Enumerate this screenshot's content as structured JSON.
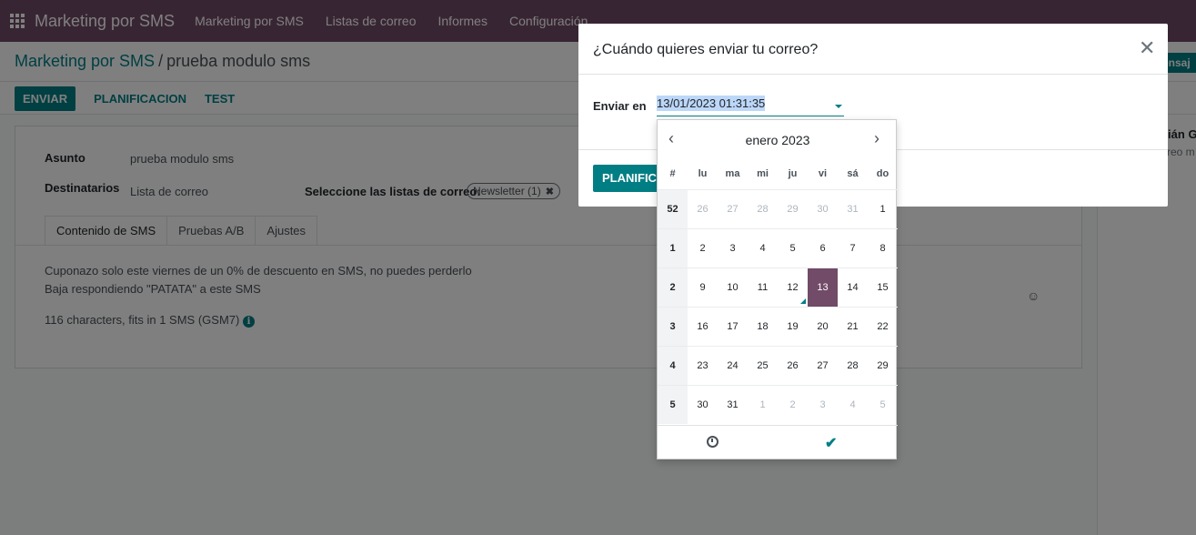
{
  "navbar": {
    "brand": "Marketing por SMS",
    "menu": [
      "Marketing por SMS",
      "Listas de correo",
      "Informes",
      "Configuración"
    ]
  },
  "breadcrumb": {
    "parent": "Marketing por SMS",
    "separator": "/",
    "current": "prueba modulo sms"
  },
  "actions": {
    "send": "ENVIAR",
    "schedule": "PLANIFICACION",
    "test": "TEST"
  },
  "form": {
    "subject_label": "Asunto",
    "subject_value": "prueba modulo sms",
    "recipients_label": "Destinatarios",
    "recipients_value": "Lista de correo",
    "lists_label": "Seleccione las listas de correo:",
    "list_tag": "Newsletter (1)",
    "tabs": [
      "Contenido de SMS",
      "Pruebas A/B",
      "Ajustes"
    ],
    "body_line1": "Cuponazo solo este viernes de un 0% de descuento en SMS, no puedes perderlo",
    "body_line2": "Baja respondiendo \"PATATA\" a este SMS",
    "char_info": "116 characters, fits in 1 SMS (GSM7)"
  },
  "chatter": {
    "button": "ensaj",
    "name": "rián G",
    "sub": "rreo m"
  },
  "modal": {
    "title": "¿Cuándo quieres enviar tu correo?",
    "send_at_label": "Enviar en",
    "send_at_value": "13/01/2023 01:31:35",
    "plan_button": "PLANIFICAR"
  },
  "datepicker": {
    "month_label": "enero 2023",
    "headers": [
      "#",
      "lu",
      "ma",
      "mi",
      "ju",
      "vi",
      "sá",
      "do"
    ],
    "weeks": [
      {
        "wk": "52",
        "days": [
          "26",
          "27",
          "28",
          "29",
          "30",
          "31",
          "1"
        ],
        "old": [
          0,
          1,
          2,
          3,
          4,
          5
        ]
      },
      {
        "wk": "1",
        "days": [
          "2",
          "3",
          "4",
          "5",
          "6",
          "7",
          "8"
        ],
        "old": []
      },
      {
        "wk": "2",
        "days": [
          "9",
          "10",
          "11",
          "12",
          "13",
          "14",
          "15"
        ],
        "old": []
      },
      {
        "wk": "3",
        "days": [
          "16",
          "17",
          "18",
          "19",
          "20",
          "21",
          "22"
        ],
        "old": []
      },
      {
        "wk": "4",
        "days": [
          "23",
          "24",
          "25",
          "26",
          "27",
          "28",
          "29"
        ],
        "old": []
      },
      {
        "wk": "5",
        "days": [
          "30",
          "31",
          "1",
          "2",
          "3",
          "4",
          "5"
        ],
        "old": [
          2,
          3,
          4,
          5,
          6
        ]
      }
    ],
    "today": "12",
    "selected": "13"
  }
}
